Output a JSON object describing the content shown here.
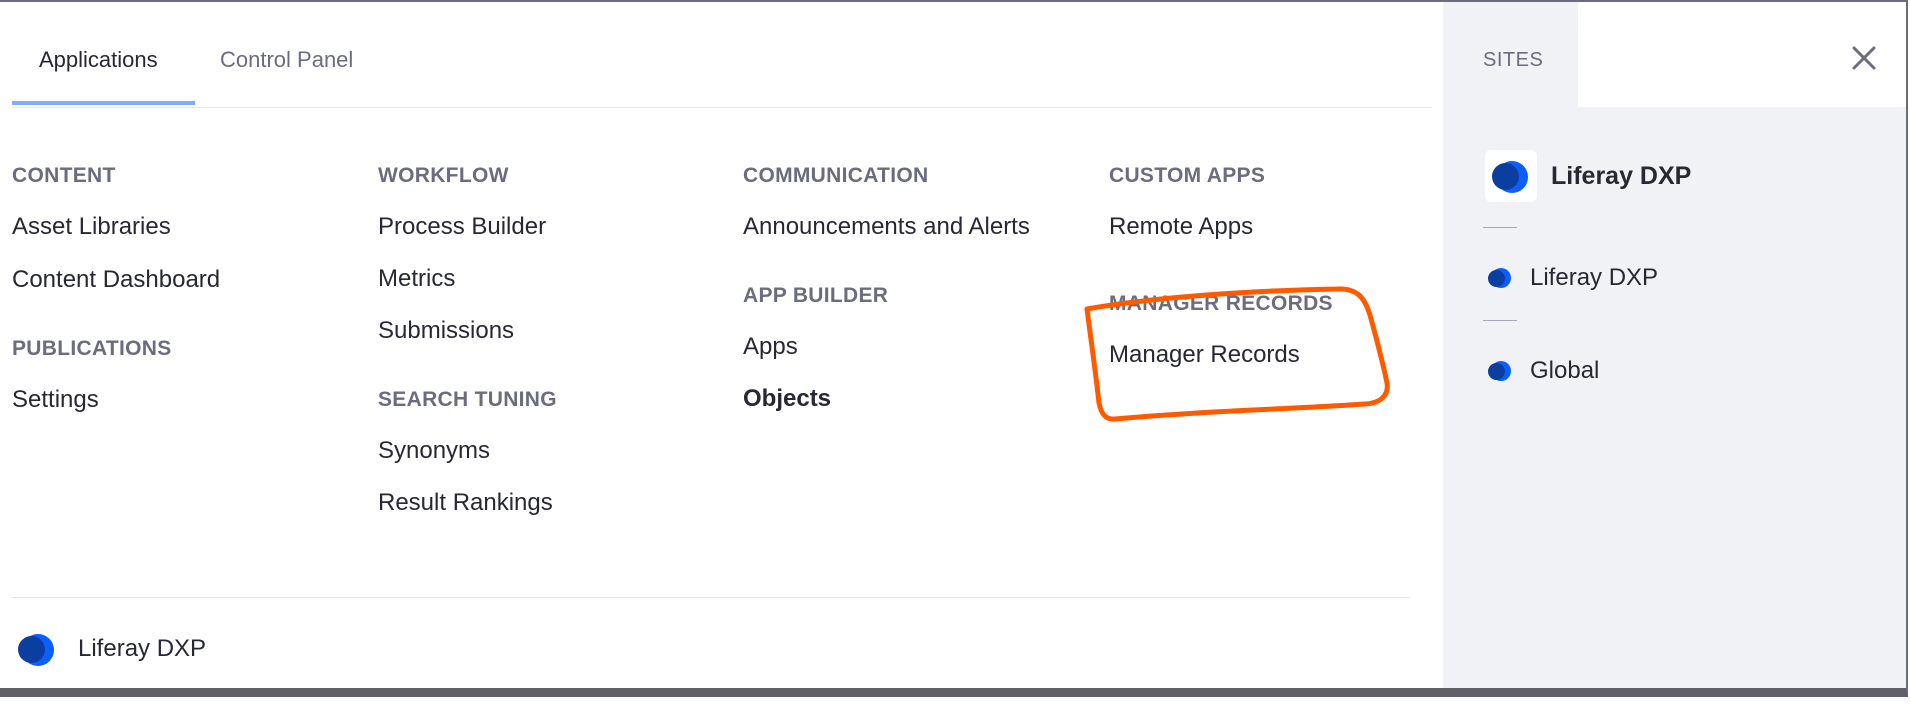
{
  "tabs": [
    {
      "label": "Applications",
      "active": true
    },
    {
      "label": "Control Panel",
      "active": false
    }
  ],
  "columns": [
    {
      "groups": [
        {
          "title": "CONTENT",
          "items": [
            "Asset Libraries",
            "Content Dashboard"
          ]
        },
        {
          "title": "PUBLICATIONS",
          "items": [
            "Settings"
          ]
        }
      ]
    },
    {
      "groups": [
        {
          "title": "WORKFLOW",
          "items": [
            "Process Builder",
            "Metrics",
            "Submissions"
          ]
        },
        {
          "title": "SEARCH TUNING",
          "items": [
            "Synonyms",
            "Result Rankings"
          ]
        }
      ]
    },
    {
      "groups": [
        {
          "title": "COMMUNICATION",
          "items": [
            "Announcements and Alerts"
          ]
        },
        {
          "title": "APP BUILDER",
          "items": [
            "Apps",
            "Objects"
          ]
        }
      ]
    },
    {
      "groups": [
        {
          "title": "CUSTOM APPS",
          "items": [
            "Remote Apps"
          ]
        },
        {
          "title": "MANAGER RECORDS",
          "items": [
            "Manager Records"
          ]
        }
      ]
    }
  ],
  "footer": {
    "brand": "Liferay DXP"
  },
  "sidebar": {
    "tab_label": "SITES",
    "close_icon": "close-icon",
    "current_site": "Liferay DXP",
    "sites": [
      "Liferay DXP",
      "Global"
    ]
  },
  "colors": {
    "accent": "#80acff",
    "brand_blue": "#0b5fff",
    "annotation": "#ff5a00"
  }
}
